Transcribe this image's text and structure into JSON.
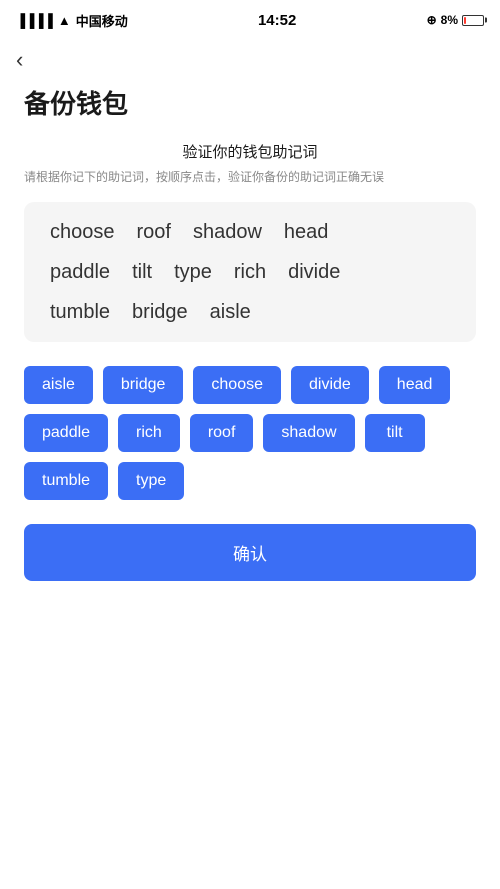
{
  "statusBar": {
    "carrier": "中国移动",
    "time": "14:52",
    "battery": "8%"
  },
  "nav": {
    "backIcon": "‹"
  },
  "pageTitle": "备份钱包",
  "sectionTitle": "验证你的钱包助记词",
  "sectionDesc": "请根据你记下的助记词，按顺序点击，验证你备份的助记词正确无误",
  "displayWords": {
    "row1": [
      "choose",
      "roof",
      "shadow",
      "head"
    ],
    "row2": [
      "paddle",
      "tilt",
      "type",
      "rich",
      "divide"
    ],
    "row3": [
      "tumble",
      "bridge",
      "aisle"
    ]
  },
  "chips": [
    "aisle",
    "bridge",
    "choose",
    "divide",
    "head",
    "paddle",
    "rich",
    "roof",
    "shadow",
    "tilt",
    "tumble",
    "type"
  ],
  "confirmBtn": "确认"
}
